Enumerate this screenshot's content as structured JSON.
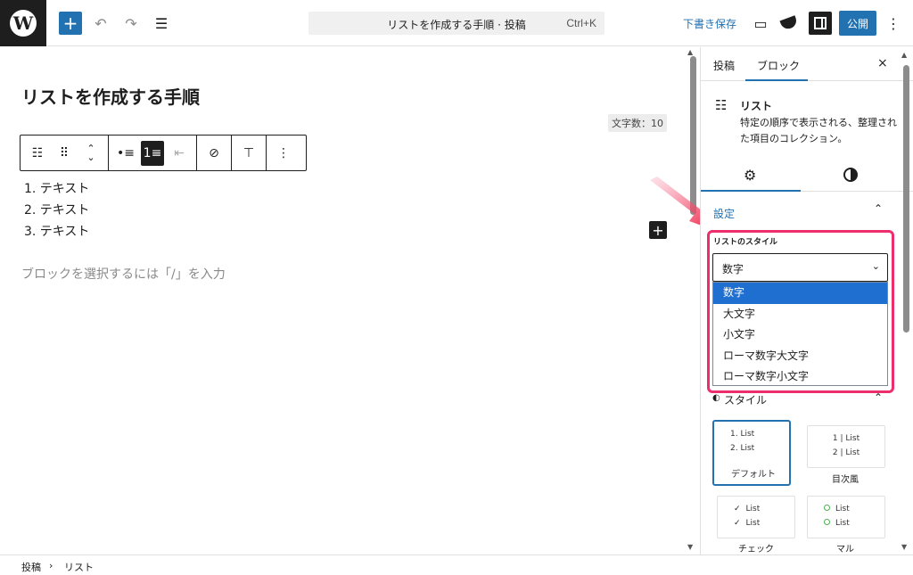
{
  "topbar": {
    "command_title": "リストを作成する手順 · 投稿",
    "command_shortcut": "Ctrl+K",
    "draft_save": "下書き保存",
    "publish": "公開",
    "icons": [
      "wordpress-logo",
      "plus-icon",
      "undo-icon",
      "redo-icon",
      "document-overview-icon",
      "preview-icon",
      "jetpack-icon",
      "settings-icon",
      "more-icon"
    ]
  },
  "editor": {
    "post_title": "リストを作成する手順",
    "word_count": "文字数：10",
    "list_items": [
      "1. テキスト",
      "2. テキスト",
      "3. テキスト"
    ],
    "placeholder": "ブロックを選択するには「/」を入力"
  },
  "sidebar": {
    "tabs": [
      "投稿",
      "ブロック"
    ],
    "active_tab": "ブロック",
    "close": "×",
    "block_name": "リスト",
    "block_description": "特定の順序で表示される、整理された項目のコレクション。",
    "section_title": "設定",
    "list_style_label": "リストのスタイル",
    "select_value": "数字",
    "options": [
      "数字",
      "大文字",
      "小文字",
      "ローマ数字大文字",
      "ローマ数字小文字"
    ],
    "selected_option": "数字",
    "style_section": "スタイル",
    "style_cards": [
      {
        "label": "デフォルト",
        "lines": [
          "1. List",
          "2. List"
        ],
        "active": true
      },
      {
        "label": "目次風",
        "lines": [
          "1 | List",
          "2 | List"
        ],
        "active": false
      },
      {
        "label": "チェック",
        "lines": [
          "List",
          "List"
        ],
        "active": false
      },
      {
        "label": "マル",
        "lines": [
          "List",
          "List"
        ],
        "active": false
      }
    ]
  },
  "footer": {
    "crumb1": "投稿",
    "separator": "›",
    "crumb2": "リスト"
  },
  "colors": {
    "accent": "#2271b1",
    "highlight": "#ee2d6d",
    "selected_option": "#1f6fd1"
  }
}
